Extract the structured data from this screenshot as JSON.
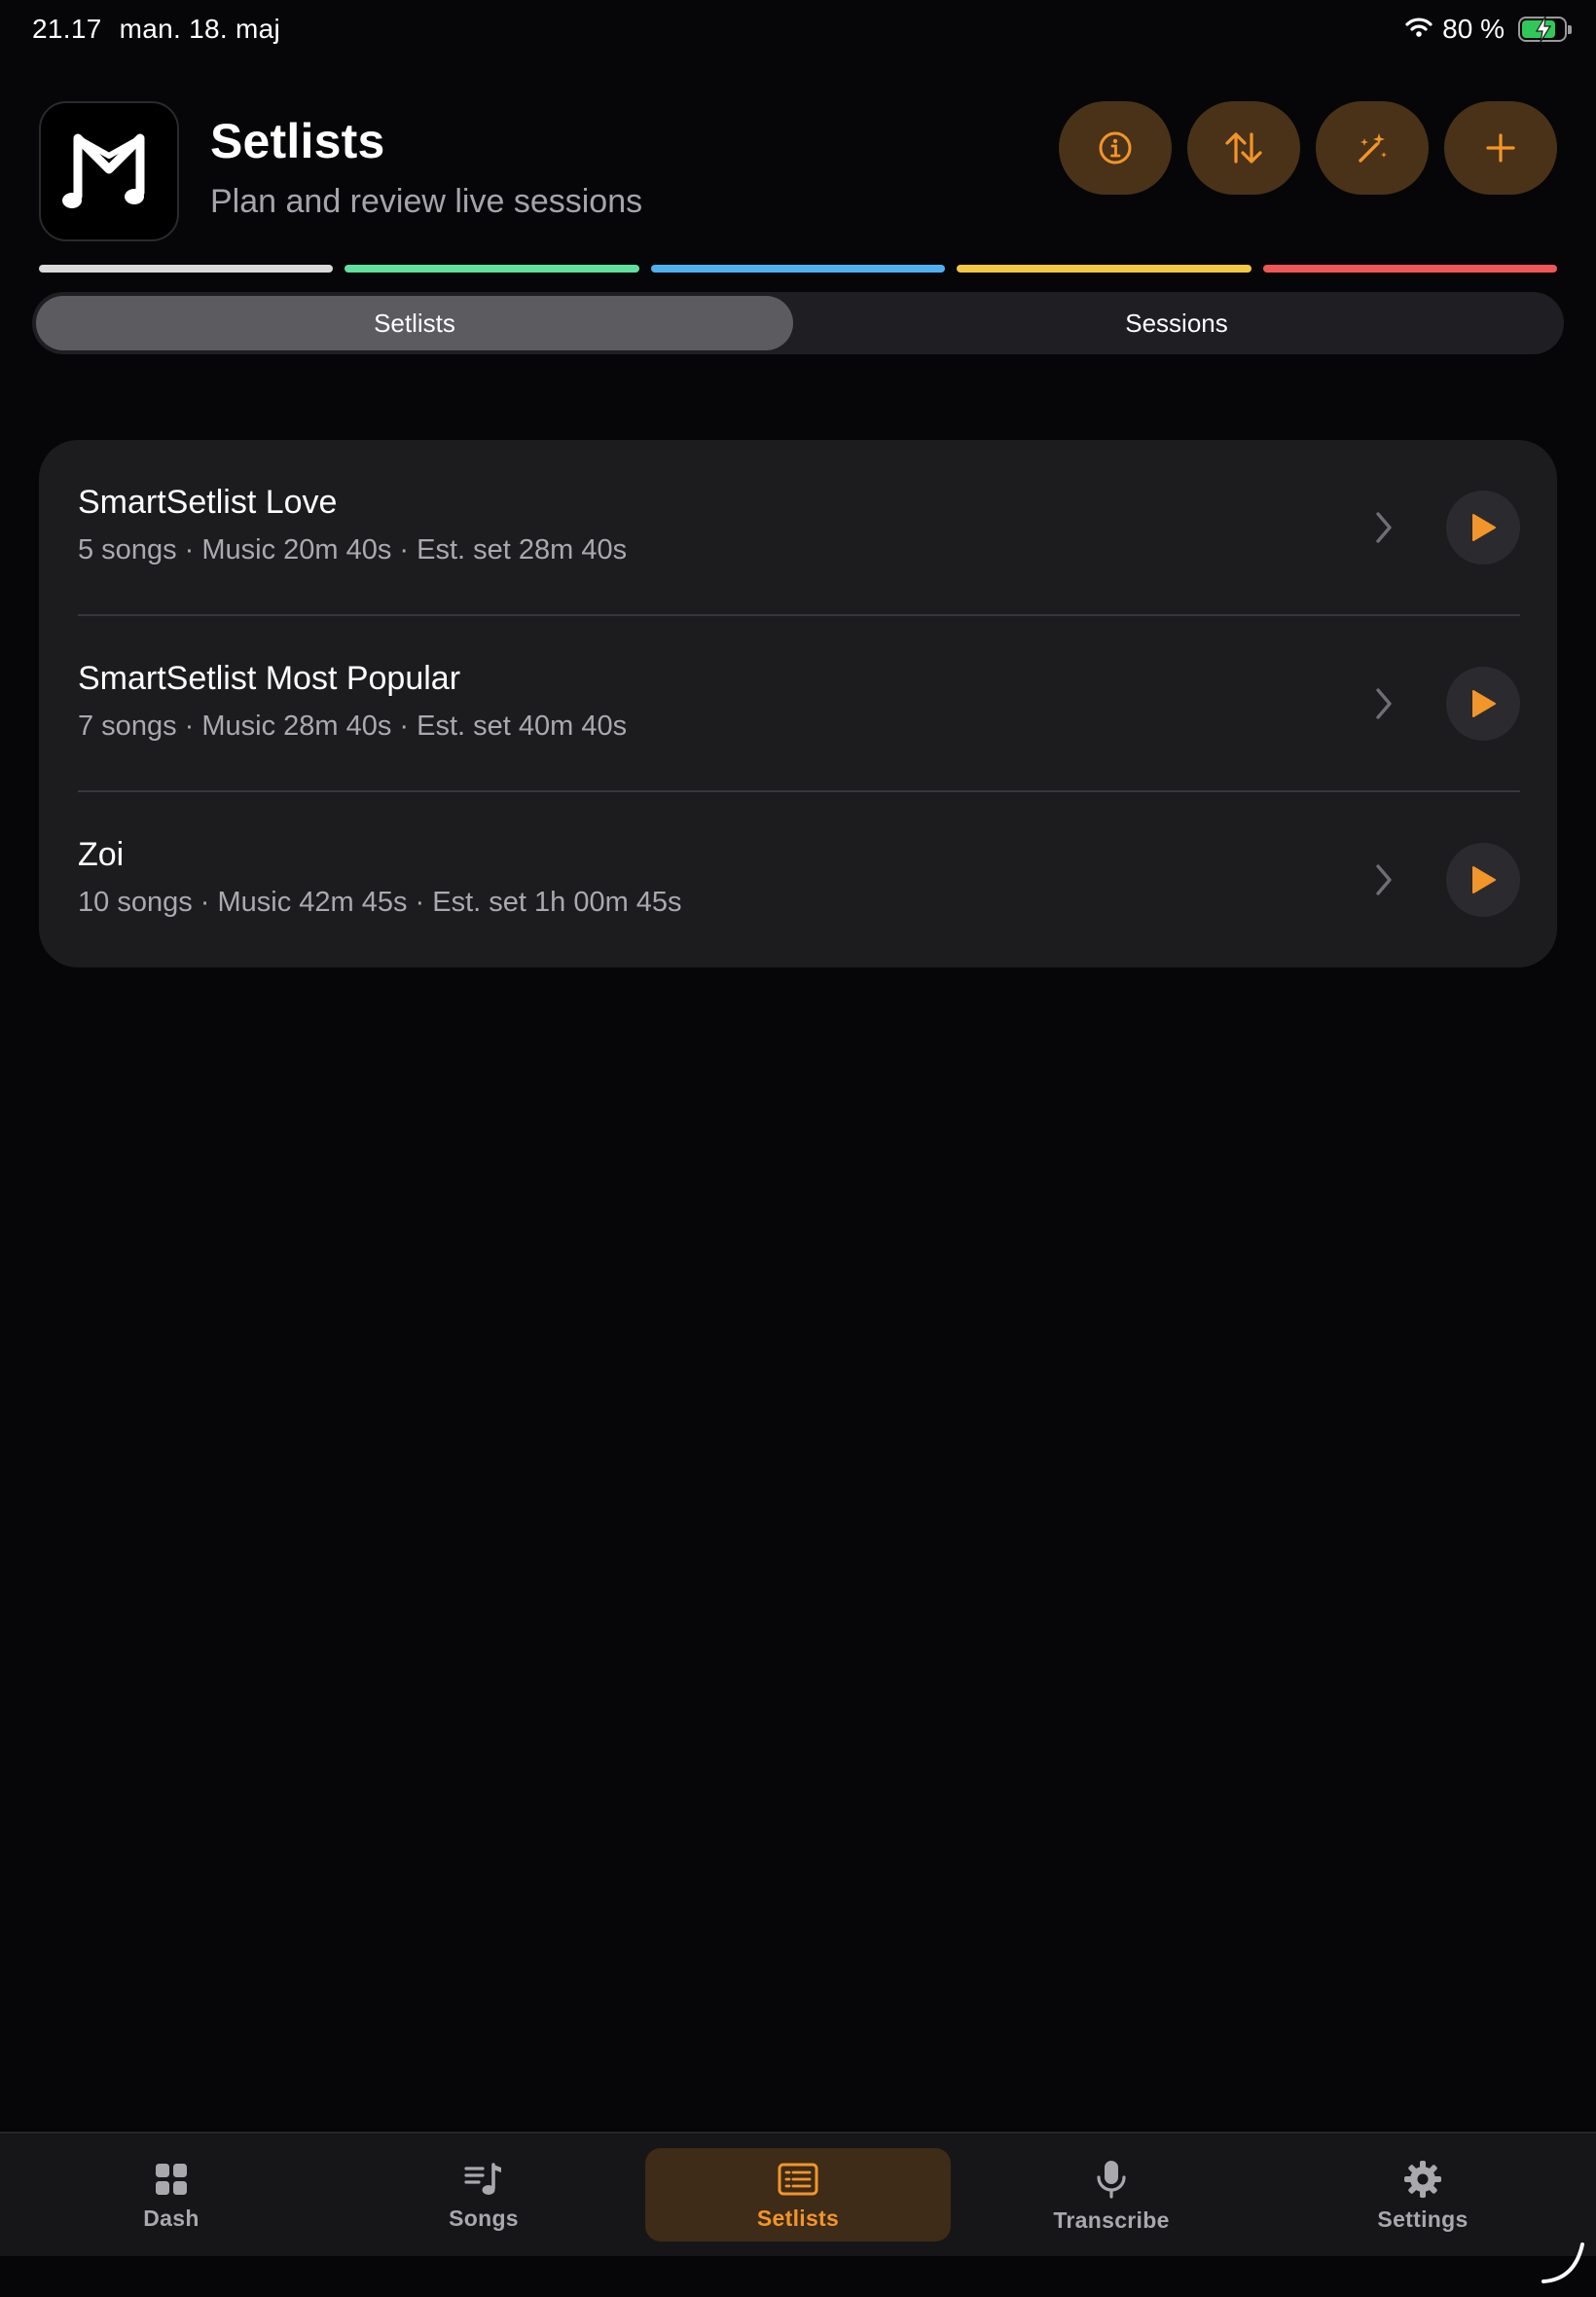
{
  "status_bar": {
    "time": "21.17",
    "date": "man. 18. maj",
    "battery_percent": "80 %",
    "battery_level": 0.8
  },
  "header": {
    "title": "Setlists",
    "subtitle": "Plan and review live sessions",
    "logo_icon": "music-m-logo-icon",
    "actions": [
      {
        "icon": "info-icon"
      },
      {
        "icon": "sort-icon"
      },
      {
        "icon": "magic-wand-icon"
      },
      {
        "icon": "plus-icon"
      }
    ]
  },
  "color_strips": [
    "#d9d9d9",
    "#5fe0a0",
    "#4fb0f0",
    "#f5c843",
    "#f05656"
  ],
  "segmented": {
    "options": [
      "Setlists",
      "Sessions"
    ],
    "selected": "Setlists"
  },
  "setlists": [
    {
      "name": "SmartSetlist Love",
      "meta": "5 songs · Music 20m 40s · Est. set 28m 40s"
    },
    {
      "name": "SmartSetlist Most Popular",
      "meta": "7 songs · Music 28m 40s · Est. set 40m 40s"
    },
    {
      "name": "Zoi",
      "meta": "10 songs · Music 42m 45s · Est. set 1h 00m 45s"
    }
  ],
  "tab_bar": {
    "tabs": [
      {
        "label": "Dash",
        "icon": "grid-icon"
      },
      {
        "label": "Songs",
        "icon": "music-list-icon"
      },
      {
        "label": "Setlists",
        "icon": "setlist-icon"
      },
      {
        "label": "Transcribe",
        "icon": "microphone-icon"
      },
      {
        "label": "Settings",
        "icon": "gear-icon"
      }
    ],
    "active": "Setlists"
  },
  "colors": {
    "accent": "#f2952a",
    "action_button_bg": "#4a3218",
    "card_bg": "#1c1c1f",
    "background": "#060608"
  }
}
